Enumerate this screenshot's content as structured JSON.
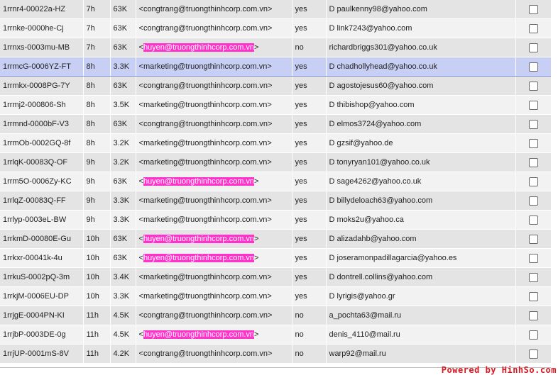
{
  "rows": [
    {
      "id": "1rrnr4-00022a-HZ",
      "age": "7h",
      "size": "63K",
      "from_prefix": "<",
      "from": "congtrang@truongthinhcorp.com.vn",
      "from_suffix": ">",
      "highlight": false,
      "frozen": "yes",
      "to": "D paulkenny98@yahoo.com",
      "selected": false
    },
    {
      "id": "1rrnke-0000he-Cj",
      "age": "7h",
      "size": "63K",
      "from_prefix": "<",
      "from": "congtrang@truongthinhcorp.com.vn",
      "from_suffix": ">",
      "highlight": false,
      "frozen": "yes",
      "to": "D link7243@yahoo.com",
      "selected": false
    },
    {
      "id": "1rrnxs-0003mu-MB",
      "age": "7h",
      "size": "63K",
      "from_prefix": "<",
      "from": "huyen@truongthinhcorp.com.vn",
      "from_suffix": ">",
      "highlight": true,
      "frozen": "no",
      "to": "richardbriggs301@yahoo.co.uk",
      "selected": false
    },
    {
      "id": "1rrmcG-0006YZ-FT",
      "age": "8h",
      "size": "3.3K",
      "from_prefix": "<",
      "from": "marketing@truongthinhcorp.com.vn",
      "from_suffix": ">",
      "highlight": false,
      "frozen": "yes",
      "to": "D chadhollyhead@yahoo.co.uk",
      "selected": true
    },
    {
      "id": "1rrmkx-0008PG-7Y",
      "age": "8h",
      "size": "63K",
      "from_prefix": "<",
      "from": "congtrang@truongthinhcorp.com.vn",
      "from_suffix": ">",
      "highlight": false,
      "frozen": "yes",
      "to": "D agostojesus60@yahoo.com",
      "selected": false
    },
    {
      "id": "1rrmj2-000806-Sh",
      "age": "8h",
      "size": "3.5K",
      "from_prefix": "<",
      "from": "marketing@truongthinhcorp.com.vn",
      "from_suffix": ">",
      "highlight": false,
      "frozen": "yes",
      "to": "D thibishop@yahoo.com",
      "selected": false
    },
    {
      "id": "1rrmnd-0000bF-V3",
      "age": "8h",
      "size": "63K",
      "from_prefix": "<",
      "from": "congtrang@truongthinhcorp.com.vn",
      "from_suffix": ">",
      "highlight": false,
      "frozen": "yes",
      "to": "D elmos3724@yahoo.com",
      "selected": false
    },
    {
      "id": "1rrmOb-0002GQ-8f",
      "age": "8h",
      "size": "3.2K",
      "from_prefix": "<",
      "from": "marketing@truongthinhcorp.com.vn",
      "from_suffix": ">",
      "highlight": false,
      "frozen": "yes",
      "to": "D gzsif@yahoo.de",
      "selected": false
    },
    {
      "id": "1rrlqK-00083Q-OF",
      "age": "9h",
      "size": "3.2K",
      "from_prefix": "<",
      "from": "marketing@truongthinhcorp.com.vn",
      "from_suffix": ">",
      "highlight": false,
      "frozen": "yes",
      "to": "D tonyryan101@yahoo.co.uk",
      "selected": false
    },
    {
      "id": "1rrm5O-0006Zy-KC",
      "age": "9h",
      "size": "63K",
      "from_prefix": "<",
      "from": "huyen@truongthinhcorp.com.vn",
      "from_suffix": ">",
      "highlight": true,
      "frozen": "yes",
      "to": "D sage4262@yahoo.co.uk",
      "selected": false
    },
    {
      "id": "1rrlqZ-00083Q-FF",
      "age": "9h",
      "size": "3.3K",
      "from_prefix": "<",
      "from": "marketing@truongthinhcorp.com.vn",
      "from_suffix": ">",
      "highlight": false,
      "frozen": "yes",
      "to": "D billydeloach63@yahoo.com",
      "selected": false
    },
    {
      "id": "1rrlyp-0003eL-BW",
      "age": "9h",
      "size": "3.3K",
      "from_prefix": "<",
      "from": "marketing@truongthinhcorp.com.vn",
      "from_suffix": ">",
      "highlight": false,
      "frozen": "yes",
      "to": "D moks2u@yahoo.ca",
      "selected": false
    },
    {
      "id": "1rrkmD-00080E-Gu",
      "age": "10h",
      "size": "63K",
      "from_prefix": "<",
      "from": "huyen@truongthinhcorp.com.vn",
      "from_suffix": ">",
      "highlight": true,
      "frozen": "yes",
      "to": "D alizadahb@yahoo.com",
      "selected": false
    },
    {
      "id": "1rrkxr-00041k-4u",
      "age": "10h",
      "size": "63K",
      "from_prefix": "<",
      "from": "huyen@truongthinhcorp.com.vn",
      "from_suffix": ">",
      "highlight": true,
      "frozen": "yes",
      "to": "D joseramonpadillagarcia@yahoo.es",
      "selected": false
    },
    {
      "id": "1rrkuS-0002pQ-3m",
      "age": "10h",
      "size": "3.4K",
      "from_prefix": "<",
      "from": "marketing@truongthinhcorp.com.vn",
      "from_suffix": ">",
      "highlight": false,
      "frozen": "yes",
      "to": "D dontrell.collins@yahoo.com",
      "selected": false
    },
    {
      "id": "1rrkjM-0006EU-DP",
      "age": "10h",
      "size": "3.3K",
      "from_prefix": "<",
      "from": "marketing@truongthinhcorp.com.vn",
      "from_suffix": ">",
      "highlight": false,
      "frozen": "yes",
      "to": "D lyrigis@yahoo.gr",
      "selected": false
    },
    {
      "id": "1rrjgE-0004PN-KI",
      "age": "11h",
      "size": "4.5K",
      "from_prefix": "<",
      "from": "congtrang@truongthinhcorp.com.vn",
      "from_suffix": ">",
      "highlight": false,
      "frozen": "no",
      "to": "a_pochta63@mail.ru",
      "selected": false
    },
    {
      "id": "1rrjbP-0003DE-0g",
      "age": "11h",
      "size": "4.5K",
      "from_prefix": "<",
      "from": "huyen@truongthinhcorp.com.vn",
      "from_suffix": ">",
      "highlight": true,
      "frozen": "no",
      "to": "denis_4110@mail.ru",
      "selected": false
    },
    {
      "id": "1rrjUP-0001mS-8V",
      "age": "11h",
      "size": "4.2K",
      "from_prefix": "<",
      "from": "congtrang@truongthinhcorp.com.vn",
      "from_suffix": ">",
      "highlight": false,
      "frozen": "no",
      "to": "warp92@mail.ru",
      "selected": false
    }
  ],
  "watermark": "Powered by HinhSo.com",
  "colors": {
    "row_odd": "#e4e4e4",
    "row_even": "#f2f2f2",
    "row_selected": "#c7cff4",
    "highlight": "#ff33cc",
    "watermark": "#d8161f"
  }
}
